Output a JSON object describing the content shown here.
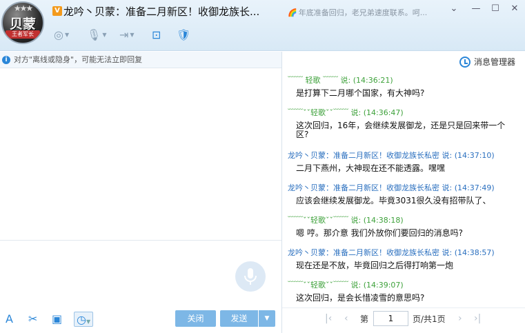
{
  "window": {
    "title": "龙吟丶贝蒙：准备二月新区！收御龙族长...",
    "signature": "年底准备回归，老兄弟速度联系。呵...",
    "vip_badge": "V",
    "avatar": {
      "big_text": "贝蒙",
      "small_text": "王者军长",
      "star_text": "★★★"
    }
  },
  "window_controls": {
    "menu": "⌄",
    "minimize": "—",
    "maximize": "☐",
    "close": "✕"
  },
  "toolbar": {
    "video_icon": "◎",
    "voice_icon": "🎙",
    "file_icon": "⇥",
    "screen_icon": "⊡",
    "security_icon": "🛡"
  },
  "notice": "对方\"离线或隐身\"，可能无法立即回复",
  "right_header": {
    "message_manager": "消息管理器"
  },
  "messages": [
    {
      "sender": "﹋﹋ 轻歌 ﹋﹋",
      "says": "说:",
      "time": "(14:36:21)",
      "text": "是打算下二月哪个国家，有大神吗?",
      "self": true
    },
    {
      "sender": "﹋﹋ˇˇ轻歌ˇˇ﹋﹋",
      "says": "说:",
      "time": "(14:36:47)",
      "text": "这次回归，16年，会继续发展御龙，还是只是回来带一个区?",
      "self": true
    },
    {
      "sender": "龙吟丶贝蒙：准备二月新区！收御龙族长私密",
      "says": "说:",
      "time": "(14:37:10)",
      "text": "二月下燕州，大神现在还不能透露。嘿嘿",
      "self": false
    },
    {
      "sender": "龙吟丶贝蒙：准备二月新区！收御龙族长私密",
      "says": "说:",
      "time": "(14:37:49)",
      "text": "应该会继续发展御龙。毕竟3031很久没有招带队了、",
      "self": false
    },
    {
      "sender": "﹋﹋ˇˇ轻歌ˇˇ﹋﹋",
      "says": "说:",
      "time": "(14:38:18)",
      "text": "嗯 哼。那介意 我们外放你们要回归的消息吗?",
      "self": true
    },
    {
      "sender": "龙吟丶贝蒙：准备二月新区！收御龙族长私密",
      "says": "说:",
      "time": "(14:38:57)",
      "text": "现在还是不放，毕竟回归之后得打响第一炮",
      "self": false
    },
    {
      "sender": "﹋﹋ˇˇ轻歌ˇˇ﹋﹋",
      "says": "说:",
      "time": "(14:39:07)",
      "text": "这次回归，是会长惜凌雪的意思吗?",
      "self": true
    }
  ],
  "bottom_toolbar": {
    "font_icon": "A",
    "scissors_icon": "✂",
    "image_icon": "▣",
    "history_icon": "◷"
  },
  "buttons": {
    "close": "关闭",
    "send": "发送",
    "send_dropdown": "▼"
  },
  "pager": {
    "first": "|‹",
    "prev": "‹",
    "label_before": "第",
    "current_page": "1",
    "label_after": "页/共1页",
    "next": "›",
    "last": "›|"
  }
}
